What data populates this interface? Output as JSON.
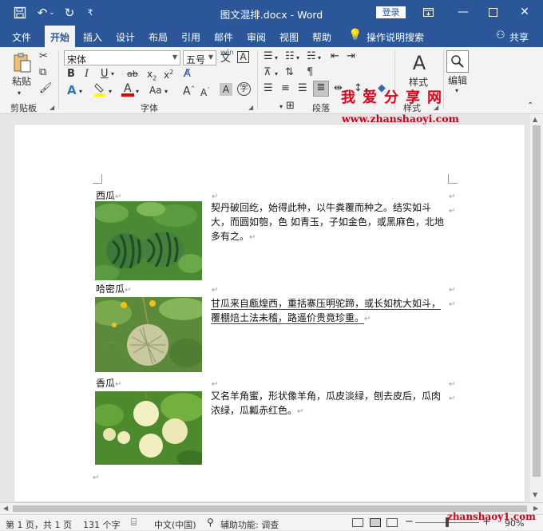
{
  "titlebar": {
    "title": "图文混排.docx  -  Word",
    "login": "登录",
    "qat_more": "₹"
  },
  "tabs": [
    {
      "label": "文件"
    },
    {
      "label": "开始"
    },
    {
      "label": "插入"
    },
    {
      "label": "设计"
    },
    {
      "label": "布局"
    },
    {
      "label": "引用"
    },
    {
      "label": "邮件"
    },
    {
      "label": "审阅"
    },
    {
      "label": "视图"
    },
    {
      "label": "帮助"
    }
  ],
  "tell_me": "操作说明搜索",
  "share": "共享",
  "ribbon": {
    "paste": "粘贴",
    "clipboard": "剪贴板",
    "font_name": "宋体",
    "font_size": "五号",
    "font_group": "字体",
    "paragraph_group": "段落",
    "styles": "样式",
    "styles_group": "样式",
    "editing": "编辑",
    "wen": "wén"
  },
  "watermark": {
    "title": "我爱分享网",
    "url": "www.zhanshaoyi.com"
  },
  "document": {
    "items": [
      {
        "label": "西瓜",
        "text_a": "契丹破回纥，始得此种，以牛粪覆而种之。结实如斗大，而圆如匏，色 如青玉，子如金色，或黑麻色，北地多有之。"
      },
      {
        "label": "哈密瓜",
        "text_a": "甘瓜来自甗煌西，重括寨压明驼蹄，或长如枕大如斗，覆棚焙土法未稽，路遥价贵竟珍重。"
      },
      {
        "label": "香瓜",
        "text_a": "又名羊角蜜，形状像羊角，瓜皮淡绿，刨去皮后，瓜肉浓绿，瓜瓤赤红色。"
      }
    ]
  },
  "status": {
    "page": "第 1 页，共 1 页",
    "words": "131 个字",
    "lang": "中文(中国)",
    "accessibility": "辅助功能: 调查",
    "zoom": "90%",
    "watermark_url": "zhanshaoy1.com"
  },
  "colors": {
    "brand": "#2b579a",
    "highlight": "#ffff00",
    "font_color": "#e00000",
    "watermark": "#e2001a"
  }
}
